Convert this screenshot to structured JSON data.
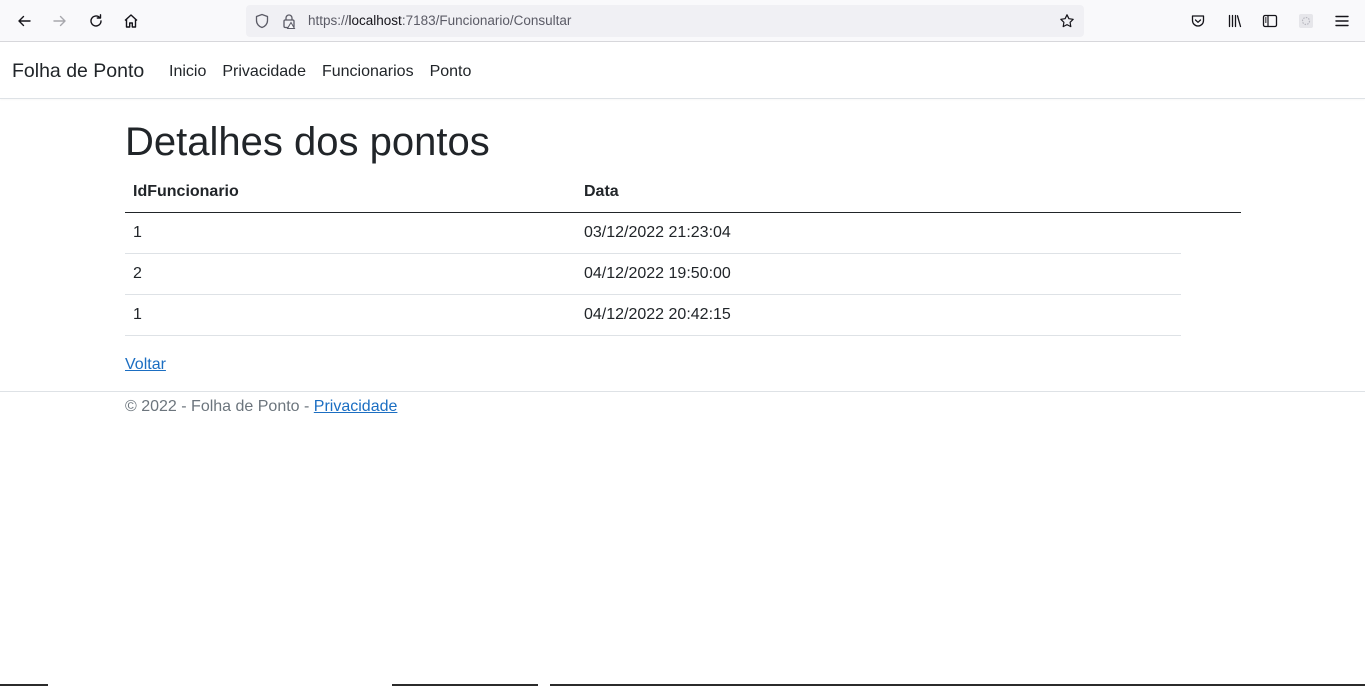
{
  "browser": {
    "url_prefix": "https://",
    "url_host": "localhost",
    "url_rest": ":7183/Funcionario/Consultar"
  },
  "navbar": {
    "brand": "Folha de Ponto",
    "links": [
      "Inicio",
      "Privacidade",
      "Funcionarios",
      "Ponto"
    ]
  },
  "main": {
    "title": "Detalhes dos pontos",
    "table": {
      "headers": [
        "IdFuncionario",
        "Data"
      ],
      "rows": [
        [
          "1",
          "03/12/2022 21:23:04"
        ],
        [
          "2",
          "04/12/2022 19:50:00"
        ],
        [
          "1",
          "04/12/2022 20:42:15"
        ]
      ]
    },
    "back_link": "Voltar"
  },
  "footer": {
    "text": "© 2022 - Folha de Ponto - ",
    "link": "Privacidade"
  }
}
